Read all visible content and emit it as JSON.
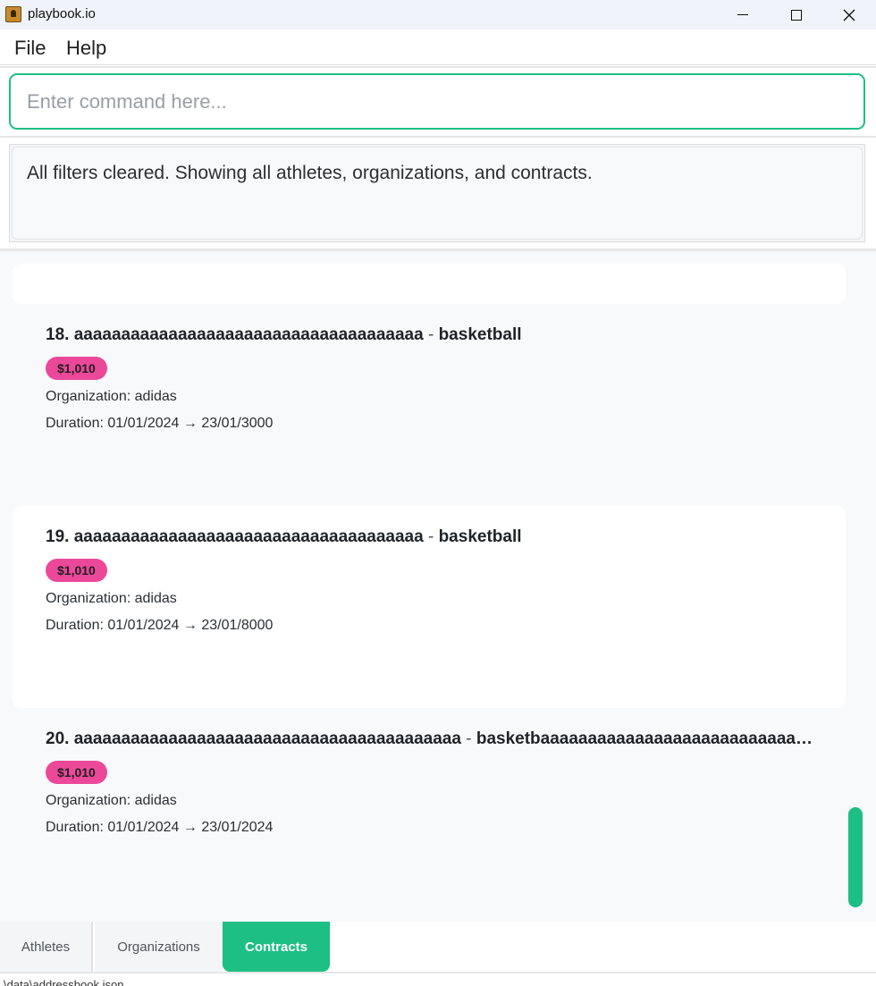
{
  "window": {
    "title": "playbook.io"
  },
  "menu": {
    "file": "File",
    "help": "Help"
  },
  "command": {
    "placeholder": "Enter command here...",
    "value": ""
  },
  "result": {
    "message": "All filters cleared. Showing all athletes, organizations, and contracts."
  },
  "contracts": [
    {
      "index": "18.",
      "athlete": "aaaaaaaaaaaaaaaaaaaaaaaaaaaaaaaaaaaaa",
      "separator": " - ",
      "sport": "basketball",
      "amount": "$1,010",
      "organization": "Organization: adidas",
      "duration": "Duration: 01/01/2024 → 23/01/3000"
    },
    {
      "index": "19.",
      "athlete": "aaaaaaaaaaaaaaaaaaaaaaaaaaaaaaaaaaaaa",
      "separator": " - ",
      "sport": "basketball",
      "amount": "$1,010",
      "organization": "Organization: adidas",
      "duration": "Duration: 01/01/2024 → 23/01/8000"
    },
    {
      "index": "20.",
      "athlete": "aaaaaaaaaaaaaaaaaaaaaaaaaaaaaaaaaaaaaaaaa",
      "separator": " - ",
      "sport": "basketbaaaaaaaaaaaaaaaaaaaaaaaaaaaaaa...",
      "amount": "$1,010",
      "organization": "Organization: adidas",
      "duration": "Duration: 01/01/2024 → 23/01/2024"
    }
  ],
  "tabs": {
    "athletes": "Athletes",
    "organizations": "Organizations",
    "contracts": "Contracts"
  },
  "status": {
    "text": "\\data\\addressbook.json"
  },
  "colors": {
    "accent": "#1dbf84",
    "badge": "#ec4899"
  }
}
